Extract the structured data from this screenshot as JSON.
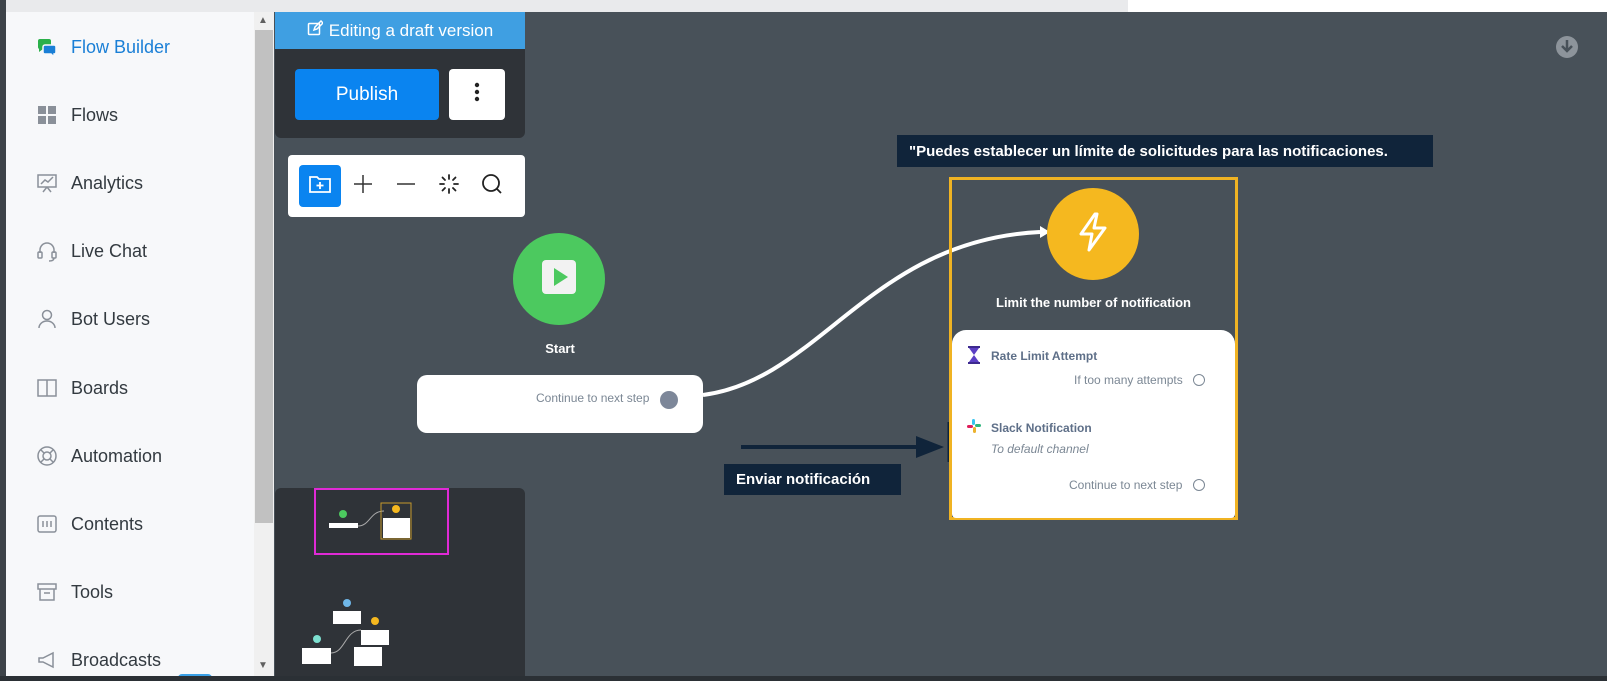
{
  "app": {
    "title": "Flow Builder"
  },
  "sidebar": {
    "items": [
      {
        "label": "Flow Builder",
        "icon": "chat-bubbles-icon",
        "active": true
      },
      {
        "label": "Flows",
        "icon": "grid-icon"
      },
      {
        "label": "Analytics",
        "icon": "presentation-chart-icon"
      },
      {
        "label": "Live Chat",
        "icon": "headset-icon"
      },
      {
        "label": "Bot Users",
        "icon": "user-icon"
      },
      {
        "label": "Boards",
        "icon": "columns-icon"
      },
      {
        "label": "Automation",
        "icon": "lifebuoy-icon"
      },
      {
        "label": "Contents",
        "icon": "contents-icon"
      },
      {
        "label": "Tools",
        "icon": "archive-box-icon"
      },
      {
        "label": "Broadcasts",
        "icon": "megaphone-icon"
      }
    ]
  },
  "editor": {
    "banner": "Editing a draft version",
    "publish_label": "Publish"
  },
  "toolbar": {
    "tools": [
      "add-folder-icon",
      "zoom-in-icon",
      "zoom-out-icon",
      "auto-layout-icon",
      "search-icon"
    ]
  },
  "canvas": {
    "start_node": {
      "label": "Start",
      "output": "Continue to next step"
    },
    "limit_node": {
      "label": "Limit the number of notification",
      "rows": [
        {
          "title": "Rate Limit Attempt",
          "output": "If too many attempts"
        },
        {
          "title": "Slack Notification",
          "subtitle": "To default channel",
          "output": "Continue to next step"
        }
      ]
    }
  },
  "annotations": {
    "top": "\"Puedes establecer un límite de solicitudes para las notificaciones.",
    "bottom": "Enviar notificación"
  },
  "colors": {
    "canvas_bg": "#485159",
    "accent_blue": "#0a84f0",
    "start_green": "#4cc95f",
    "limit_yellow": "#f5b81f",
    "annotation_bg": "#10243a",
    "minimap_highlight": "#e02ad6"
  }
}
